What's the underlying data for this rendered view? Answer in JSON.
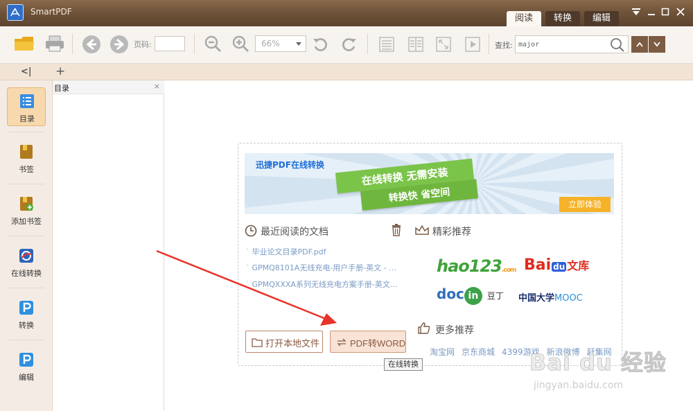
{
  "window": {
    "title": "SmartPDF",
    "modes": [
      {
        "label": "阅读",
        "active": true
      },
      {
        "label": "转换",
        "active": false
      },
      {
        "label": "编辑",
        "active": false
      }
    ]
  },
  "toolbar": {
    "page_label": "页码:",
    "page_value": "",
    "zoom_value": "66%",
    "search_label": "查找:",
    "search_value": "major"
  },
  "tabstrip": {
    "collapse": "<|",
    "add": "+"
  },
  "sidebar": {
    "items": [
      {
        "label": "目录",
        "active": true
      },
      {
        "label": "书签",
        "active": false
      },
      {
        "label": "添加书签",
        "active": false
      },
      {
        "label": "在线转换",
        "active": false
      },
      {
        "label": "转换",
        "active": false
      },
      {
        "label": "编辑",
        "active": false
      }
    ]
  },
  "toc": {
    "title": "目录",
    "close": "×"
  },
  "welcome": {
    "banner_brand": "迅捷PDF在线转换",
    "banner_line1": "在线转换 无需安装",
    "banner_line2": "转换快 省空间",
    "try_button": "立即体验",
    "recent_heading": "最近阅读的文档",
    "recent_files": [
      "毕业论文目录PDF.pdf",
      "GPMQ8101A无线充电-用户手册-英文 - ...",
      "GPMQXXXA系列无线充电方案手册-英文..."
    ],
    "recommend_heading": "精彩推荐",
    "logos": {
      "hao123": "hao123",
      "hao123_small": ".com",
      "baidu_bai": "Bai",
      "baidu_du": "du",
      "baidu_wk": "文库",
      "docin_doc": "doc",
      "docin_in": "in",
      "docin_cn": "豆丁",
      "mooc_cn": "中国大学",
      "mooc_en": "MOOC"
    },
    "more_heading": "更多推荐",
    "open_local_button": "打开本地文件",
    "pdf_word_button": "PDF转WORD",
    "tooltip": "在线转换",
    "links": [
      "淘宝网",
      "京东商城",
      "4399游戏",
      "新浪微博",
      "赶集网"
    ]
  },
  "watermark": {
    "text": "Bai du 经验",
    "url": "jingyan.baidu.com"
  },
  "colors": {
    "titlebar": "#6e5238",
    "accent_brown": "#7c5c42",
    "banner_green": "#7bc44a",
    "try_orange": "#f6b228",
    "annotation_red": "#e8332a"
  }
}
